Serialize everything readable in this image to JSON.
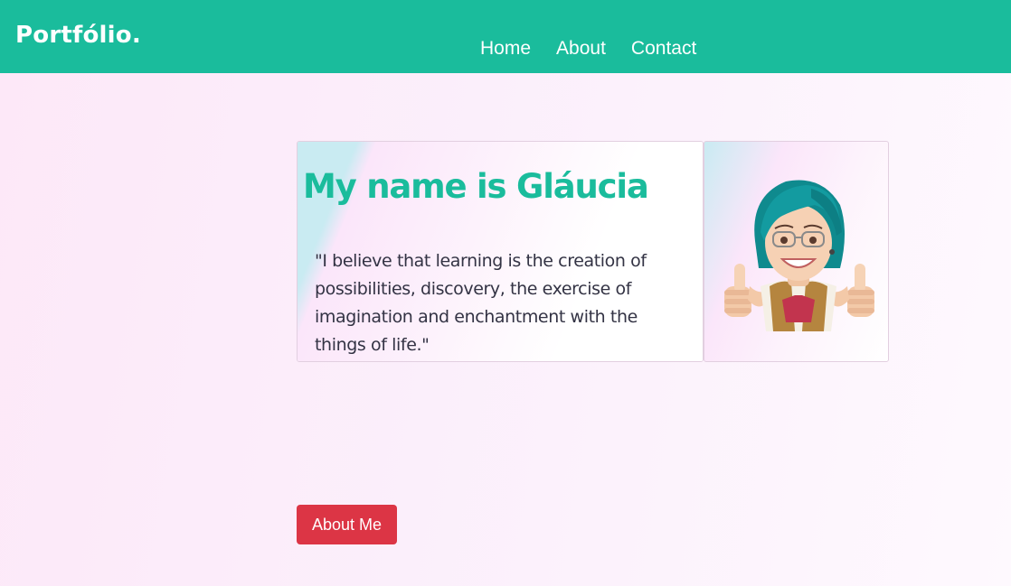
{
  "navbar": {
    "brand": "Portfólio.",
    "links": [
      "Home",
      "About",
      "Contact"
    ]
  },
  "hero": {
    "title": "My name is Gláucia",
    "quote": "\"I believe that learning is the creation of possibilities, discovery, the exercise of imagination and enchantment with the things of life.\"",
    "avatar_icon": "avatar-thumbs-up-illustration"
  },
  "actions": {
    "about_button": "About Me"
  },
  "colors": {
    "accent": "#1abc9c",
    "button": "#dc3545",
    "text": "#333344"
  }
}
